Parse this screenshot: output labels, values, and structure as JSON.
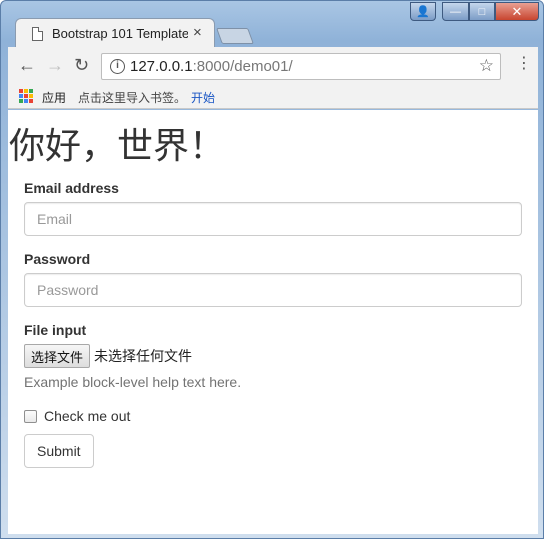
{
  "browser": {
    "tab_title": "Bootstrap 101 Template",
    "tab_close": "×",
    "url_host": "127.0.0.1",
    "url_rest": ":8000/demo01/",
    "info_glyph": "i",
    "star_glyph": "☆",
    "menu_glyph": "⋮",
    "back_glyph": "←",
    "forward_glyph": "→",
    "reload_glyph": "↻",
    "window_buttons": {
      "minimize": "—",
      "maximize": "□",
      "close": "✕",
      "user": "👤"
    },
    "bookmarks": {
      "apps_label": "应用",
      "hint": "点击这里导入书签。",
      "link": "开始",
      "apps_colors": [
        "#e94235",
        "#fbbc04",
        "#34a853",
        "#4285f4",
        "#e94235",
        "#fbbc04",
        "#34a853",
        "#4285f4",
        "#e94235"
      ]
    }
  },
  "page": {
    "heading": "你好，世界！",
    "email": {
      "label": "Email address",
      "placeholder": "Email"
    },
    "password": {
      "label": "Password",
      "placeholder": "Password"
    },
    "file": {
      "label": "File input",
      "button": "选择文件",
      "status": "未选择任何文件",
      "help": "Example block-level help text here."
    },
    "checkbox_label": "Check me out",
    "submit_label": "Submit"
  }
}
